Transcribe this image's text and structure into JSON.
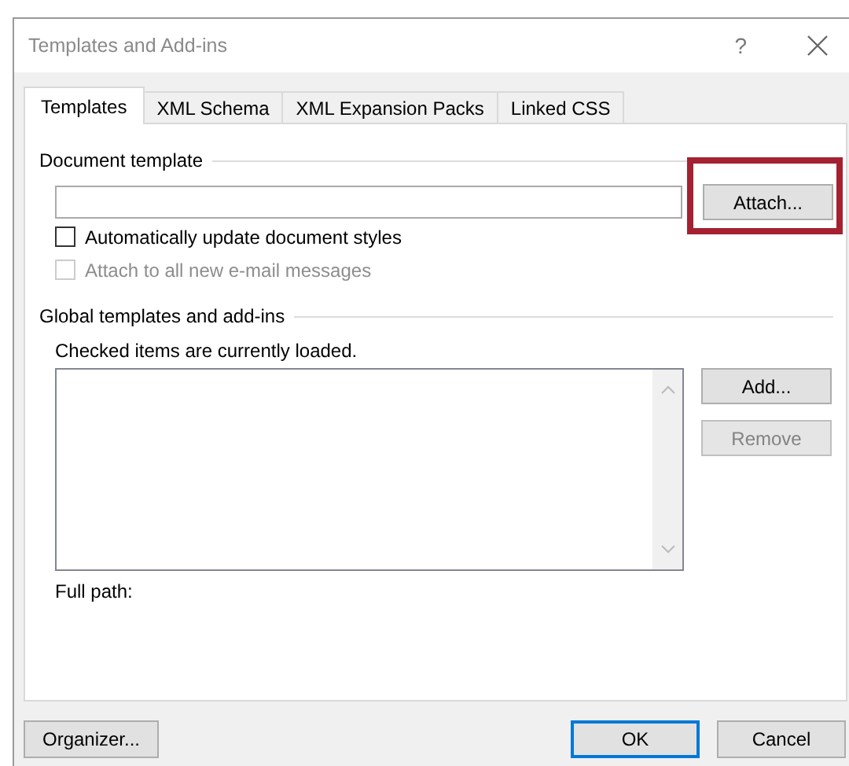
{
  "window": {
    "title": "Templates and Add-ins",
    "help": "?"
  },
  "tabs": [
    {
      "label": "Templates",
      "selected": true
    },
    {
      "label": "XML Schema",
      "selected": false
    },
    {
      "label": "XML Expansion Packs",
      "selected": false
    },
    {
      "label": "Linked CSS",
      "selected": false
    }
  ],
  "document_template": {
    "heading": "Document template",
    "attach_button": {
      "label": "Attach...",
      "highlighted": true
    }
  },
  "options": [
    {
      "label": "Automatically update document styles",
      "checked": false,
      "disabled": false
    },
    {
      "label": "Attach to all new e-mail messages",
      "checked": false,
      "disabled": true
    }
  ],
  "global": {
    "heading": "Global templates and add-ins",
    "note": "Checked items are currently loaded.",
    "full_path_label": "Full path:",
    "buttons": [
      {
        "label": "Add...",
        "disabled": false
      },
      {
        "label": "Remove",
        "disabled": true
      }
    ]
  },
  "footer_buttons": [
    {
      "label": "Organizer...",
      "default": false
    },
    {
      "label": "OK",
      "default": true
    },
    {
      "label": "Cancel",
      "default": false
    }
  ]
}
